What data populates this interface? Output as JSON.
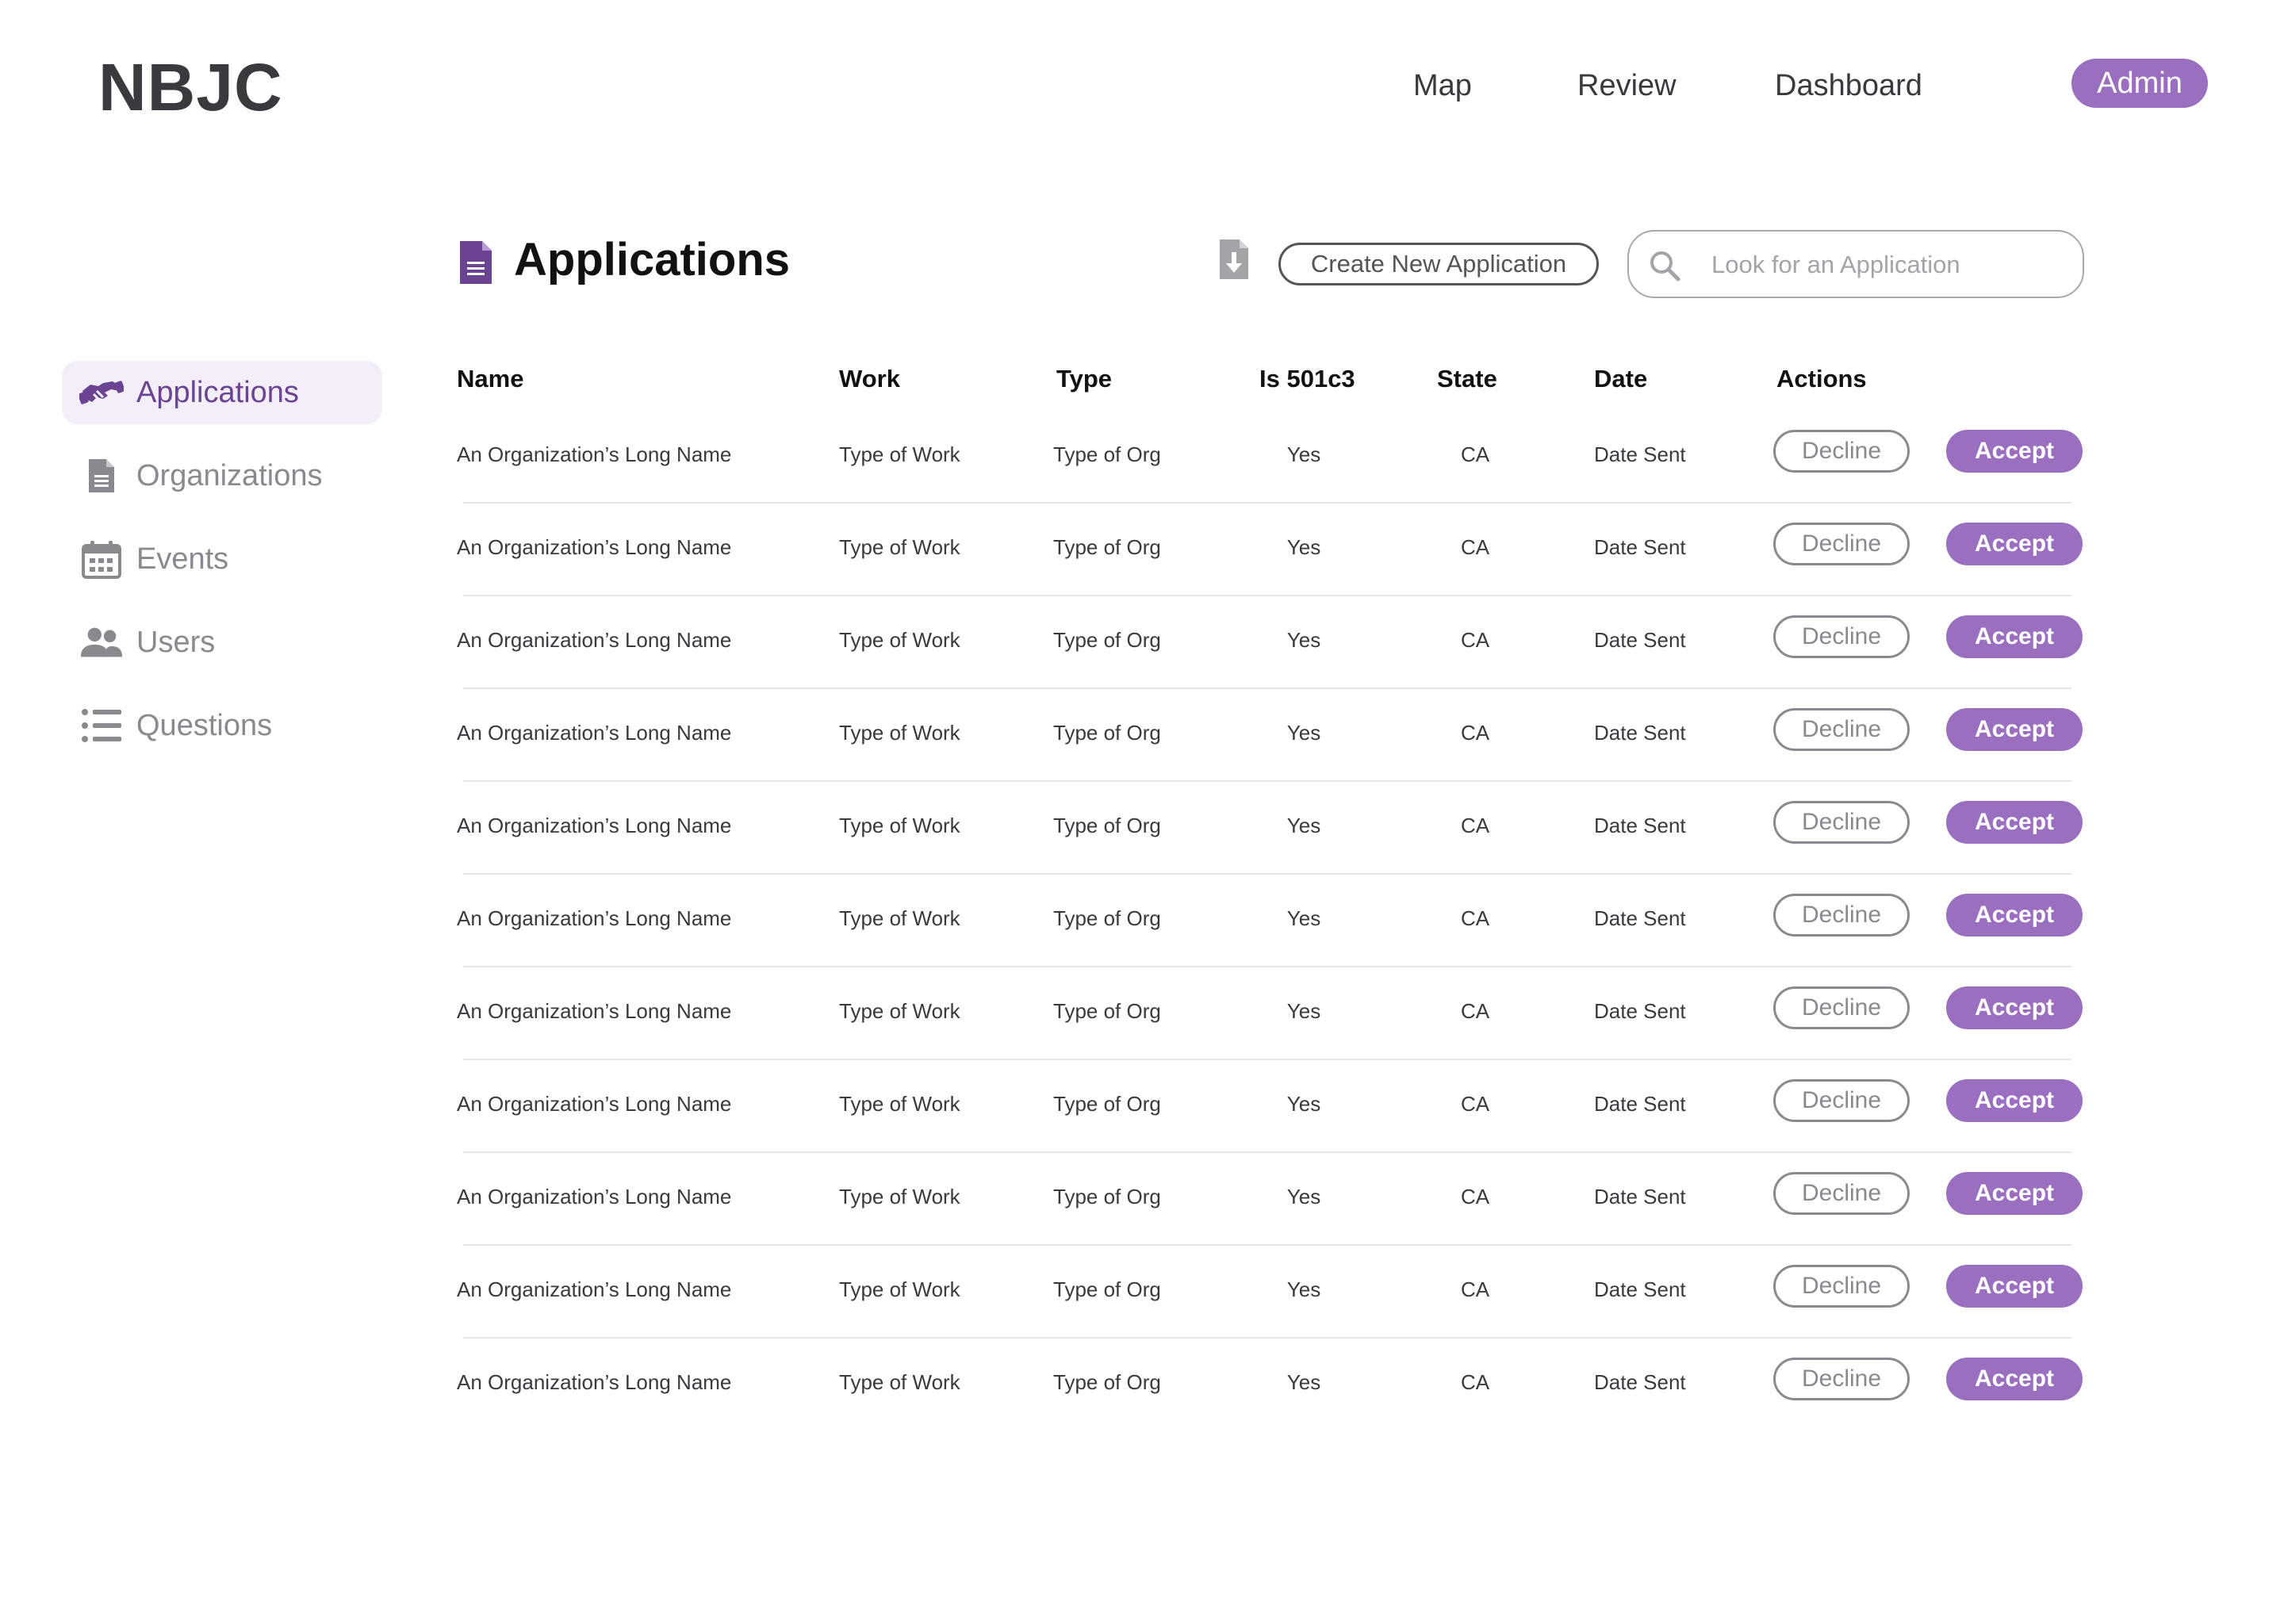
{
  "brand": {
    "logo": "NBJC"
  },
  "topnav": {
    "items": [
      {
        "label": "Map"
      },
      {
        "label": "Review"
      },
      {
        "label": "Dashboard"
      }
    ],
    "admin_label": "Admin"
  },
  "sidebar": {
    "items": [
      {
        "label": "Applications",
        "icon": "handshake-icon",
        "active": true
      },
      {
        "label": "Organizations",
        "icon": "document-icon",
        "active": false
      },
      {
        "label": "Events",
        "icon": "calendar-icon",
        "active": false
      },
      {
        "label": "Users",
        "icon": "users-icon",
        "active": false
      },
      {
        "label": "Questions",
        "icon": "list-icon",
        "active": false
      }
    ]
  },
  "main": {
    "title": "Applications",
    "title_icon": "document-icon",
    "export_icon": "download-file-icon",
    "create_label": "Create New Application",
    "search_placeholder": "Look for an Application"
  },
  "table": {
    "columns": {
      "name": "Name",
      "work": "Work",
      "type": "Type",
      "is501c3": "Is 501c3",
      "state": "State",
      "date": "Date",
      "actions": "Actions"
    },
    "decline_label": "Decline",
    "accept_label": "Accept",
    "rows": [
      {
        "name": "An Organization’s Long Name",
        "work": "Type of Work",
        "type": "Type of Org",
        "is501c3": "Yes",
        "state": "CA",
        "date": "Date Sent"
      },
      {
        "name": "An Organization’s Long Name",
        "work": "Type of Work",
        "type": "Type of Org",
        "is501c3": "Yes",
        "state": "CA",
        "date": "Date Sent"
      },
      {
        "name": "An Organization’s Long Name",
        "work": "Type of Work",
        "type": "Type of Org",
        "is501c3": "Yes",
        "state": "CA",
        "date": "Date Sent"
      },
      {
        "name": "An Organization’s Long Name",
        "work": "Type of Work",
        "type": "Type of Org",
        "is501c3": "Yes",
        "state": "CA",
        "date": "Date Sent"
      },
      {
        "name": "An Organization’s Long Name",
        "work": "Type of Work",
        "type": "Type of Org",
        "is501c3": "Yes",
        "state": "CA",
        "date": "Date Sent"
      },
      {
        "name": "An Organization’s Long Name",
        "work": "Type of Work",
        "type": "Type of Org",
        "is501c3": "Yes",
        "state": "CA",
        "date": "Date Sent"
      },
      {
        "name": "An Organization’s Long Name",
        "work": "Type of Work",
        "type": "Type of Org",
        "is501c3": "Yes",
        "state": "CA",
        "date": "Date Sent"
      },
      {
        "name": "An Organization’s Long Name",
        "work": "Type of Work",
        "type": "Type of Org",
        "is501c3": "Yes",
        "state": "CA",
        "date": "Date Sent"
      },
      {
        "name": "An Organization’s Long Name",
        "work": "Type of Work",
        "type": "Type of Org",
        "is501c3": "Yes",
        "state": "CA",
        "date": "Date Sent"
      },
      {
        "name": "An Organization’s Long Name",
        "work": "Type of Work",
        "type": "Type of Org",
        "is501c3": "Yes",
        "state": "CA",
        "date": "Date Sent"
      },
      {
        "name": "An Organization’s Long Name",
        "work": "Type of Work",
        "type": "Type of Org",
        "is501c3": "Yes",
        "state": "CA",
        "date": "Date Sent"
      }
    ]
  },
  "colors": {
    "accent": "#9b6fc0",
    "accent_dark": "#6b4393",
    "accent_light": "#f3eef9",
    "muted": "#8a8a8e"
  }
}
